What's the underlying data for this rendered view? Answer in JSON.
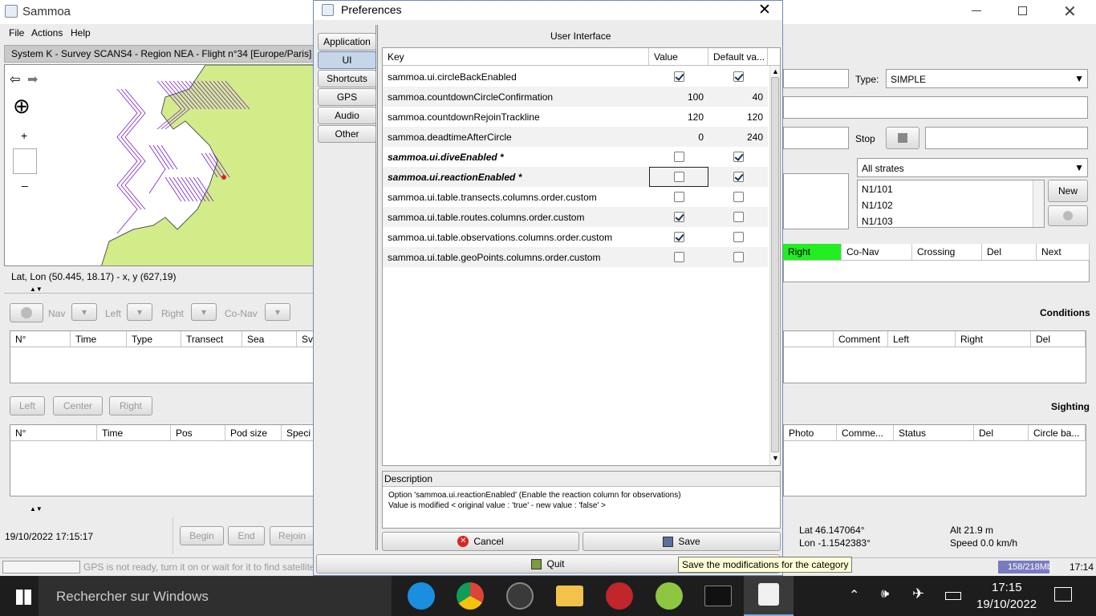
{
  "window": {
    "title": "Sammoa"
  },
  "menu": [
    "File",
    "Actions",
    "Help"
  ],
  "flight_bar": "System K - Survey SCANS4 - Region NEA - Flight n°34 [Europe/Paris]",
  "map": {
    "coords": "Lat, Lon (50.445, 18.17) - x, y (627,19)"
  },
  "right_panel": {
    "type_label": "Type:",
    "type_value": "SIMPLE",
    "stop_label": "Stop",
    "strates": "All strates",
    "transects": [
      "N1/101",
      "N1/102",
      "N1/103"
    ],
    "new_label": "New",
    "nav_cols": [
      "Right",
      "Co-Nav",
      "Crossing",
      "Del",
      "Next"
    ],
    "conditions": "Conditions",
    "cond_cols": [
      "Comment",
      "Left",
      "Right",
      "Del"
    ],
    "sighting": "Sighting",
    "sight_cols": [
      "Photo",
      "Comme...",
      "Status",
      "Del",
      "Circle ba..."
    ],
    "lat": "Lat 46.147064°",
    "lon": "Lon -1.1542383°",
    "alt": "Alt 21.9 m",
    "speed": "Speed 0.0 km/h"
  },
  "left_panel": {
    "nav_labels": [
      "Nav",
      "Left",
      "Right",
      "Co-Nav"
    ],
    "obs_cols": [
      "N°",
      "Time",
      "Type",
      "Transect",
      "Sea",
      "Sv"
    ],
    "pos_buttons": [
      "Left",
      "Center",
      "Right"
    ],
    "sight_cols": [
      "N°",
      "Time",
      "Pos",
      "Pod size",
      "Speci"
    ],
    "datetime": "19/10/2022 17:15:17",
    "actions": [
      "Begin",
      "End",
      "Rejoin"
    ],
    "gps_status": "GPS is not ready, turn it on or wait for it to find satellite",
    "memory": "158/218Mb",
    "clock": "17:14"
  },
  "dialog": {
    "title": "Preferences",
    "categories": [
      "Application",
      "UI",
      "Shortcuts",
      "GPS",
      "Audio",
      "Other"
    ],
    "selected_category": "UI",
    "section_title": "User Interface",
    "columns": [
      "Key",
      "Value",
      "Default va..."
    ],
    "rows": [
      {
        "key": "sammoa.ui.circleBackEnabled",
        "value": true,
        "default": true,
        "type": "bool"
      },
      {
        "key": "sammoa.countdownCircleConfirmation",
        "value": "100",
        "default": "40",
        "type": "num"
      },
      {
        "key": "sammoa.countdownRejoinTrackline",
        "value": "120",
        "default": "120",
        "type": "num"
      },
      {
        "key": "sammoa.deadtimeAfterCircle",
        "value": "0",
        "default": "240",
        "type": "num"
      },
      {
        "key": "sammoa.ui.diveEnabled *",
        "value": false,
        "default": true,
        "type": "bool",
        "modified": true
      },
      {
        "key": "sammoa.ui.reactionEnabled *",
        "value": false,
        "default": true,
        "type": "bool",
        "modified": true,
        "focused": true
      },
      {
        "key": "sammoa.ui.table.transects.columns.order.custom",
        "value": false,
        "default": false,
        "type": "bool"
      },
      {
        "key": "sammoa.ui.table.routes.columns.order.custom",
        "value": true,
        "default": false,
        "type": "bool"
      },
      {
        "key": "sammoa.ui.table.observations.columns.order.custom",
        "value": true,
        "default": false,
        "type": "bool"
      },
      {
        "key": "sammoa.ui.table.geoPoints.columns.order.custom",
        "value": false,
        "default": false,
        "type": "bool"
      }
    ],
    "description_label": "Description",
    "description_line1": "Option 'sammoa.ui.reactionEnabled' (Enable the reaction column for observations)",
    "description_line2": "Value is modified < original value : 'true' - new value : 'false' >",
    "cancel_label": "Cancel",
    "save_label": "Save",
    "quit_label": "Quit",
    "tooltip": "Save the modifications for the category"
  },
  "taskbar": {
    "search_placeholder": "Rechercher sur Windows",
    "time": "17:15",
    "date": "19/10/2022"
  },
  "colors": {
    "map_land": "#d2ec8a",
    "map_track": "#7a1fd6",
    "highlight_green": "#22ee22",
    "taskbar": "#1d1d1d"
  }
}
